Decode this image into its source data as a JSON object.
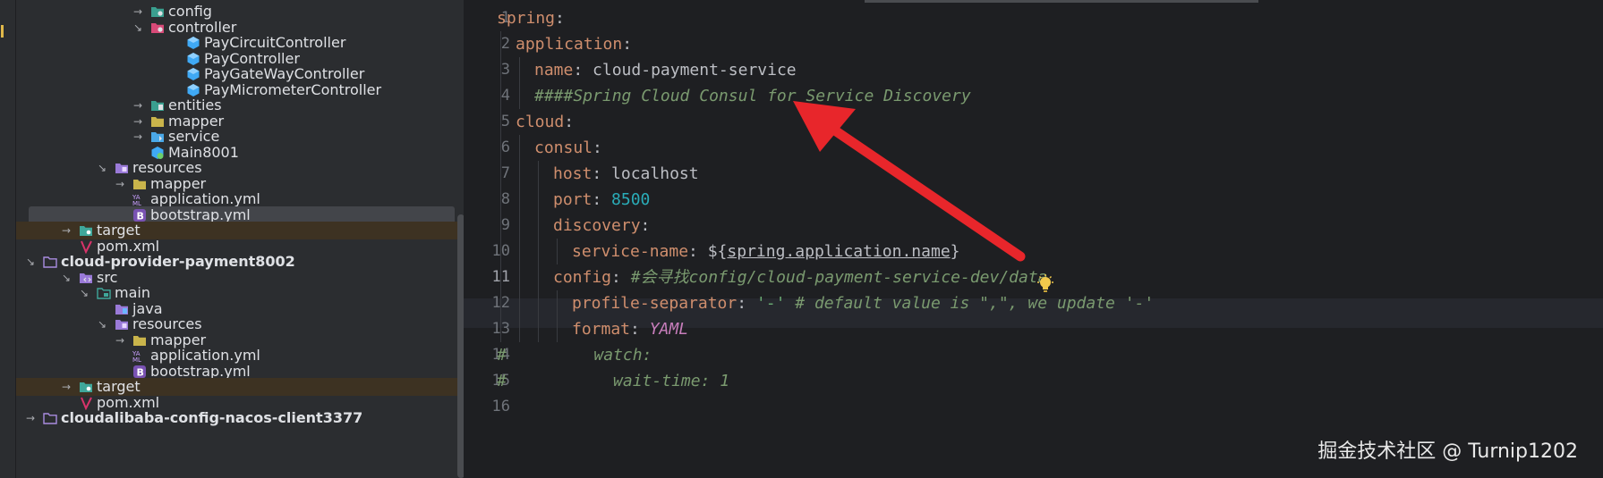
{
  "tree": {
    "rows": [
      {
        "label": "config",
        "arrow": "→",
        "icon": "config-folder-icon",
        "indent": 150
      },
      {
        "label": "controller",
        "arrow": "↘",
        "icon": "controller-folder-icon",
        "indent": 150
      },
      {
        "label": "PayCircuitController",
        "arrow": "",
        "icon": "class-icon",
        "indent": 190
      },
      {
        "label": "PayController",
        "arrow": "",
        "icon": "class-icon",
        "indent": 190
      },
      {
        "label": "PayGateWayController",
        "arrow": "",
        "icon": "class-icon",
        "indent": 190
      },
      {
        "label": "PayMicrometerController",
        "arrow": "",
        "icon": "class-icon",
        "indent": 190
      },
      {
        "label": "entities",
        "arrow": "→",
        "icon": "entities-folder-icon",
        "indent": 150
      },
      {
        "label": "mapper",
        "arrow": "→",
        "icon": "folder-icon",
        "indent": 150
      },
      {
        "label": "service",
        "arrow": "→",
        "icon": "service-folder-icon",
        "indent": 150
      },
      {
        "label": "Main8001",
        "arrow": "",
        "icon": "spring-main-icon",
        "indent": 150
      },
      {
        "label": "resources",
        "arrow": "↘",
        "icon": "resources-folder-icon",
        "indent": 110
      },
      {
        "label": "mapper",
        "arrow": "→",
        "icon": "folder-icon",
        "indent": 130
      },
      {
        "label": "application.yml",
        "arrow": "",
        "icon": "yaml-icon",
        "indent": 130
      },
      {
        "label": "bootstrap.yml",
        "arrow": "",
        "icon": "bootstrap-icon",
        "indent": 130,
        "selected": true
      },
      {
        "label": "target",
        "arrow": "→",
        "icon": "target-folder-icon",
        "indent": 70,
        "excluded": true
      },
      {
        "label": "pom.xml",
        "arrow": "",
        "icon": "maven-icon",
        "indent": 70
      },
      {
        "label": "cloud-provider-payment8002",
        "arrow": "↘",
        "icon": "module-folder-icon",
        "indent": 30,
        "bold": true
      },
      {
        "label": "src",
        "arrow": "↘",
        "icon": "src-folder-icon",
        "indent": 70
      },
      {
        "label": "main",
        "arrow": "↘",
        "icon": "main-folder-icon",
        "indent": 90
      },
      {
        "label": "java",
        "arrow": "",
        "icon": "java-folder-icon",
        "indent": 110
      },
      {
        "label": "resources",
        "arrow": "↘",
        "icon": "resources-folder-icon",
        "indent": 110
      },
      {
        "label": "mapper",
        "arrow": "→",
        "icon": "folder-icon",
        "indent": 130
      },
      {
        "label": "application.yml",
        "arrow": "",
        "icon": "yaml-icon",
        "indent": 130
      },
      {
        "label": "bootstrap.yml",
        "arrow": "",
        "icon": "bootstrap-icon",
        "indent": 130
      },
      {
        "label": "target",
        "arrow": "→",
        "icon": "target-folder-icon",
        "indent": 70,
        "excluded": true
      },
      {
        "label": "pom.xml",
        "arrow": "",
        "icon": "maven-icon",
        "indent": 70
      },
      {
        "label": "cloudalibaba-config-nacos-client3377",
        "arrow": "→",
        "icon": "module-folder-icon",
        "indent": 30,
        "bold": true
      }
    ]
  },
  "editor": {
    "current_line": 11,
    "lines": [
      {
        "n": "1",
        "indent": 0,
        "parts": [
          [
            "k",
            "spring"
          ],
          [
            "p",
            ":"
          ]
        ]
      },
      {
        "n": "2",
        "indent": 1,
        "parts": [
          [
            "k",
            "application"
          ],
          [
            "p",
            ":"
          ]
        ]
      },
      {
        "n": "3",
        "indent": 2,
        "parts": [
          [
            "k",
            "name"
          ],
          [
            "p",
            ": "
          ],
          [
            "v",
            "cloud-payment-service"
          ]
        ]
      },
      {
        "n": "4",
        "indent": 2,
        "parts": [
          [
            "c",
            "####Spring Cloud Consul for Service Discovery"
          ]
        ]
      },
      {
        "n": "5",
        "indent": 1,
        "parts": [
          [
            "k",
            "cloud"
          ],
          [
            "p",
            ":"
          ]
        ]
      },
      {
        "n": "6",
        "indent": 2,
        "parts": [
          [
            "k",
            "consul"
          ],
          [
            "p",
            ":"
          ]
        ]
      },
      {
        "n": "7",
        "indent": 3,
        "parts": [
          [
            "k",
            "host"
          ],
          [
            "p",
            ": "
          ],
          [
            "v",
            "localhost"
          ]
        ]
      },
      {
        "n": "8",
        "indent": 3,
        "parts": [
          [
            "k",
            "port"
          ],
          [
            "p",
            ": "
          ],
          [
            "n",
            "8500"
          ]
        ]
      },
      {
        "n": "9",
        "indent": 3,
        "parts": [
          [
            "k",
            "discovery"
          ],
          [
            "p",
            ":"
          ]
        ]
      },
      {
        "n": "10",
        "indent": 4,
        "parts": [
          [
            "k",
            "service-name"
          ],
          [
            "p",
            ": ${"
          ],
          [
            "u",
            "spring.application.name"
          ],
          [
            "p",
            "}"
          ]
        ]
      },
      {
        "n": "11",
        "indent": 3,
        "parts": [
          [
            "k",
            "config"
          ],
          [
            "p",
            ": "
          ],
          [
            "c",
            "#会寻找config/cloud-payment-service-dev/data"
          ]
        ]
      },
      {
        "n": "12",
        "indent": 4,
        "parts": [
          [
            "k",
            "profile-separator"
          ],
          [
            "p",
            ": "
          ],
          [
            "s",
            "'-'"
          ],
          [
            "c",
            " # default value is \",\", we update '-'"
          ]
        ]
      },
      {
        "n": "13",
        "indent": 4,
        "parts": [
          [
            "k",
            "format"
          ],
          [
            "p",
            ": "
          ],
          [
            "it",
            "YAML"
          ]
        ]
      },
      {
        "n": "14",
        "indent": -1,
        "parts": [
          [
            "c",
            "#         watch:"
          ]
        ]
      },
      {
        "n": "15",
        "indent": -1,
        "parts": [
          [
            "c",
            "#           wait-time: 1"
          ]
        ]
      },
      {
        "n": "16",
        "indent": 0,
        "parts": []
      }
    ]
  },
  "annotation": {
    "color": "#e8262b"
  },
  "watermark": "掘金技术社区 @ Turnip1202",
  "colors": {
    "folder": "#c9b44b",
    "teal": "#3a9f8f",
    "blue": "#4aa8e8",
    "purple": "#9a7ad8",
    "pink": "#d84a78",
    "red": "#e0334a"
  }
}
